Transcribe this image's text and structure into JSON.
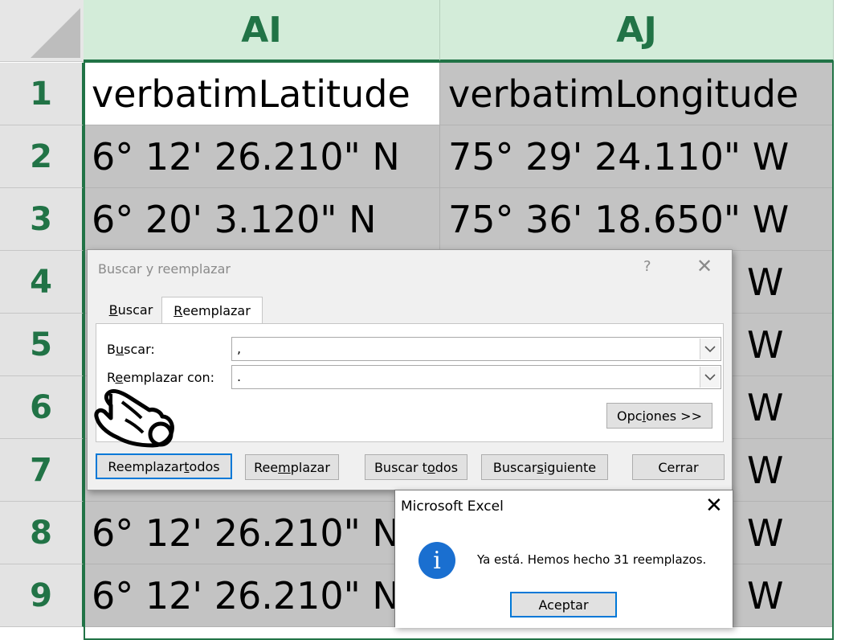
{
  "sheet": {
    "columns": [
      {
        "label": "AI"
      },
      {
        "label": "AJ"
      }
    ],
    "rows": [
      {
        "num": "1",
        "ai": "verbatimLatitude",
        "aj": "verbatimLongitude"
      },
      {
        "num": "2",
        "ai": "6° 12' 26.210\" N",
        "aj": "75° 29' 24.110\" W"
      },
      {
        "num": "3",
        "ai": "6° 20' 3.120\" N",
        "aj": "75° 36' 18.650\" W"
      },
      {
        "num": "4",
        "ai": "",
        "aj": "W"
      },
      {
        "num": "5",
        "ai": "",
        "aj": "W"
      },
      {
        "num": "6",
        "ai": "",
        "aj": "W"
      },
      {
        "num": "7",
        "ai": "",
        "aj": "W"
      },
      {
        "num": "8",
        "ai": "6° 12' 26.210\" N",
        "aj": "W"
      },
      {
        "num": "9",
        "ai": "6° 12' 26.210\" N",
        "aj": "W"
      }
    ]
  },
  "find_replace": {
    "title": "Buscar y reemplazar",
    "help": "?",
    "close": "✕",
    "tabs": {
      "buscar": {
        "u": "B",
        "rest": "uscar"
      },
      "reemplazar": {
        "u": "R",
        "rest": "eemplazar"
      }
    },
    "find_label": {
      "pre": "B",
      "u": "u",
      "post": "scar:"
    },
    "replace_label": {
      "pre": "R",
      "u": "e",
      "post": "emplazar con:"
    },
    "find_value": ",",
    "replace_value": ".",
    "options_button": {
      "pre": "Opc",
      "u": "i",
      "post": "ones >>"
    },
    "buttons": {
      "replace_all": {
        "pre": "Reemplazar ",
        "u": "t",
        "post": "odos"
      },
      "replace": {
        "pre": "Ree",
        "u": "m",
        "post": "plazar"
      },
      "find_all": {
        "pre": "Buscar t",
        "u": "o",
        "post": "dos"
      },
      "find_next": {
        "pre": "Buscar ",
        "u": "s",
        "post": "iguiente"
      },
      "close": "Cerrar"
    }
  },
  "message_box": {
    "title": "Microsoft Excel",
    "close": "✕",
    "icon_glyph": "i",
    "text": "Ya está. Hemos hecho 31 reemplazos.",
    "ok": "Aceptar"
  },
  "icons": [
    "info-icon",
    "hand-cursor-icon",
    "chevron-down-icon",
    "close-icon",
    "help-icon"
  ],
  "colors": {
    "excel_green": "#217346",
    "accent_blue": "#0078d7",
    "info_blue": "#1a6fd0"
  }
}
